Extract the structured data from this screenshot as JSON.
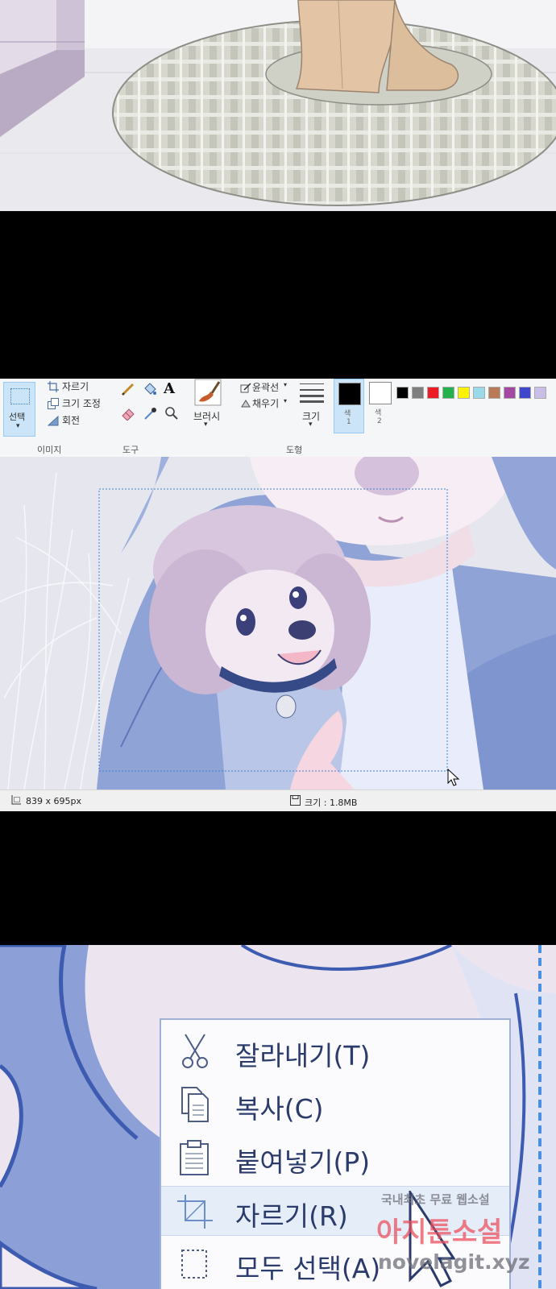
{
  "paint": {
    "ribbon": {
      "select_label": "선택",
      "crop_label": "자르기",
      "resize_label": "크기 조정",
      "rotate_label": "회전",
      "text_tool_glyph": "A",
      "brushes_label": "브러시",
      "outline_label": "윤곽선",
      "fill_label": "채우기",
      "size_label": "크기",
      "color1_label": "색",
      "color1_index": "1",
      "color2_label": "색",
      "color2_index": "2",
      "groups": {
        "image": "이미지",
        "tools": "도구",
        "shapes": "도형"
      },
      "colors": {
        "color1": "#000000",
        "color2": "#ffffff"
      },
      "palette": [
        "#000000",
        "#7f7f7f",
        "#ed1c24",
        "#22b14c",
        "#fff200",
        "#99d9ea",
        "#b97a57",
        "#a349a4",
        "#3f48cc",
        "#c8bfe7"
      ]
    },
    "status": {
      "selection_size": "839 x 695px",
      "file_size": "크기 : 1.8MB"
    }
  },
  "context_menu": {
    "items": [
      {
        "label": "잘라내기(T)",
        "icon": "scissors-icon"
      },
      {
        "label": "복사(C)",
        "icon": "copy-icon"
      },
      {
        "label": "붙여넣기(P)",
        "icon": "clipboard-icon"
      },
      {
        "label": "자르기(R)",
        "icon": "crop-icon"
      },
      {
        "label": "모두 선택(A)",
        "icon": "select-all-icon"
      }
    ]
  },
  "watermark": {
    "line1": "국내최초 무료 웹소설",
    "line2": "아지툰소설",
    "line3": "novelagit.xyz"
  }
}
